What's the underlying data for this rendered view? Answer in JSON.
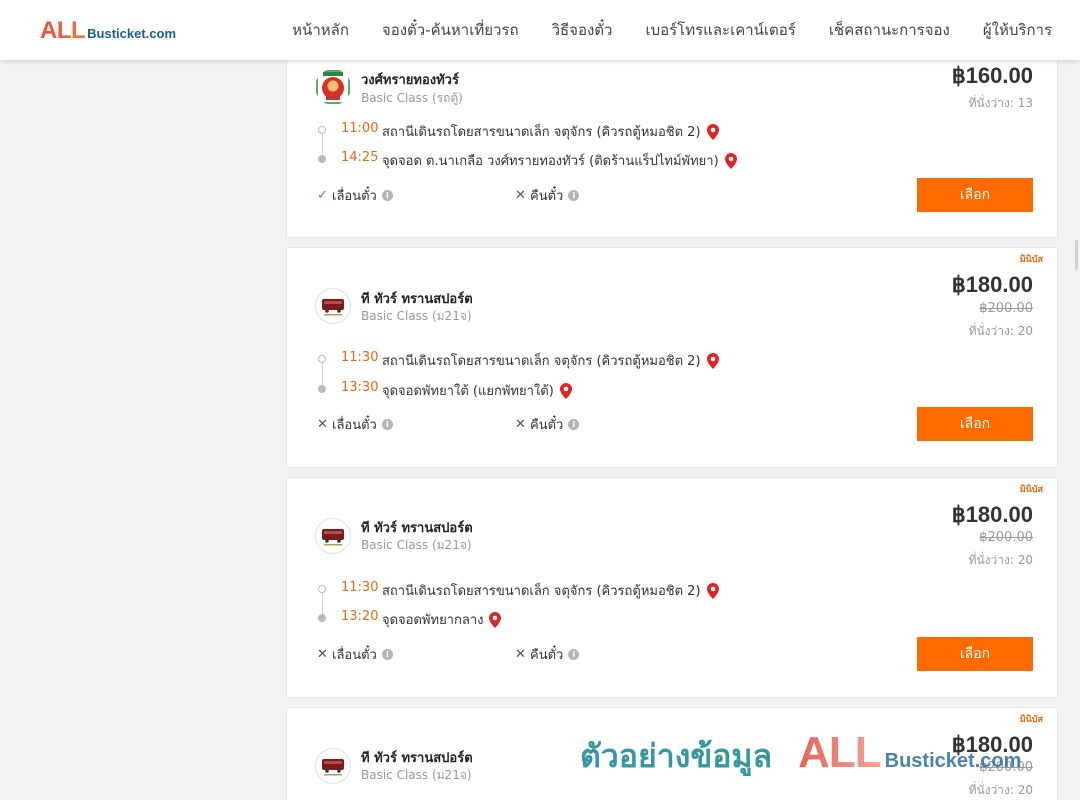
{
  "header": {
    "logo_all": "ALL",
    "logo_rest": "Busticket.com",
    "nav": [
      "หน้าหลัก",
      "จองตั๋ว-ค้นหาเที่ยวรถ",
      "วิธีจองตั๋ว",
      "เบอร์โทรและเคาน์เตอร์",
      "เช็คสถานะการจอง",
      "ผู้ให้บริการ"
    ]
  },
  "trips": [
    {
      "operator": "วงศ์ทรายทองทัวร์",
      "bus_class": "Basic Class (รถตู้)",
      "operator_logo": "wongsaithong-logo",
      "tag": "",
      "price": "฿160.00",
      "old_price": "",
      "seats": "ที่นั่งว่าง: 13",
      "depart_time": "11:00",
      "depart_place": "สถานีเดินรถโดยสารขนาดเล็ก จตุจักร (คิวรถตู้หมอชิต 2)",
      "arrive_time": "14:25",
      "arrive_place": "จุดจอด ต.นาเกลือ วงศ์ทรายทองทัวร์ (ติดร้านแร็ปไทม์พัทยา)",
      "reschedule_label": "เลื่อนตั๋ว",
      "reschedule_allowed": true,
      "refund_label": "คืนตั๋ว",
      "refund_allowed": false,
      "select_label": "เลือก"
    },
    {
      "operator": "ที ทัวร์ ทรานสปอร์ต",
      "bus_class": "Basic Class (ม21จ)",
      "operator_logo": "t-tour-bus-logo",
      "tag": "มินิบัส",
      "price": "฿180.00",
      "old_price": "฿200.00",
      "seats": "ที่นั่งว่าง: 20",
      "depart_time": "11:30",
      "depart_place": "สถานีเดินรถโดยสารขนาดเล็ก จตุจักร (คิวรถตู้หมอชิต 2)",
      "arrive_time": "13:30",
      "arrive_place": "จุดจอดพัทยาใต้ (แยกพัทยาใต้)",
      "reschedule_label": "เลื่อนตั๋ว",
      "reschedule_allowed": false,
      "refund_label": "คืนตั๋ว",
      "refund_allowed": false,
      "select_label": "เลือก"
    },
    {
      "operator": "ที ทัวร์ ทรานสปอร์ต",
      "bus_class": "Basic Class (ม21จ)",
      "operator_logo": "t-tour-bus-logo",
      "tag": "มินิบัส",
      "price": "฿180.00",
      "old_price": "฿200.00",
      "seats": "ที่นั่งว่าง: 20",
      "depart_time": "11:30",
      "depart_place": "สถานีเดินรถโดยสารขนาดเล็ก จตุจักร (คิวรถตู้หมอชิต 2)",
      "arrive_time": "13:20",
      "arrive_place": "จุดจอดพัทยากลาง",
      "reschedule_label": "เลื่อนตั๋ว",
      "reschedule_allowed": false,
      "refund_label": "คืนตั๋ว",
      "refund_allowed": false,
      "select_label": "เลือก"
    },
    {
      "operator": "ที ทัวร์ ทรานสปอร์ต",
      "bus_class": "Basic Class (ม21จ)",
      "operator_logo": "t-tour-bus-logo",
      "tag": "มินิบัส",
      "price": "฿180.00",
      "old_price": "฿200.00",
      "seats": "ที่นั่งว่าง: 20"
    }
  ],
  "watermark": {
    "text": "ตัวอย่างข้อมูล",
    "logo_all": "ALL",
    "logo_rest": "Busticket.com"
  },
  "colors": {
    "accent": "#ff6b00",
    "time": "#e86a10",
    "allowed": "#37a546",
    "pin": "#e02424"
  },
  "icons": {
    "pin": "map-pin-icon",
    "info": "info-icon",
    "allowed": "check-icon",
    "not_allowed": "cross-icon"
  }
}
